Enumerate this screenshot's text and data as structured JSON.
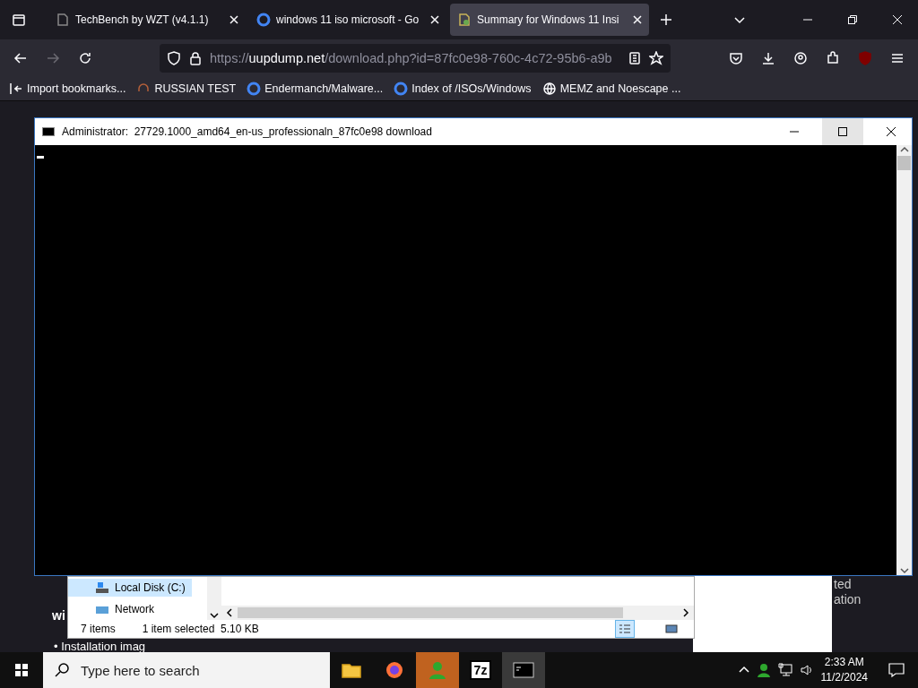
{
  "browser": {
    "tabs": [
      {
        "title": "TechBench by WZT (v4.1.1)",
        "selected": false
      },
      {
        "title": "windows 11 iso microsoft - Go",
        "selected": false
      },
      {
        "title": "Summary for Windows 11 Insi",
        "selected": true
      }
    ],
    "url": {
      "scheme": "https://",
      "host": "uupdump.net",
      "path": "/download.php?id=87fc0e98-760c-4c72-95b6-a9b"
    },
    "bookmarks": [
      {
        "label": "Import bookmarks..."
      },
      {
        "label": "RUSSIAN TEST"
      },
      {
        "label": "Endermanch/Malware..."
      },
      {
        "label": "Index of /ISOs/Windows"
      },
      {
        "label": "MEMZ and Noescape ..."
      }
    ]
  },
  "page": {
    "left_fragments": [
      "wi",
      "• Installation imag"
    ],
    "right_fragments": [
      "ted",
      "ation"
    ]
  },
  "explorer": {
    "nav_items": [
      {
        "label": "Local Disk (C:)",
        "selected": true
      },
      {
        "label": "Network",
        "selected": false
      }
    ],
    "status": {
      "count": "7 items",
      "selection": "1 item selected  5.10 KB"
    },
    "view_buttons": [
      {
        "selected": true
      },
      {
        "selected": false
      }
    ]
  },
  "console": {
    "title": "Administrator:  27729.1000_amd64_en-us_professionaln_87fc0e98 download"
  },
  "taskbar": {
    "search_placeholder": "Type here to search",
    "apps": [
      {
        "active": false
      },
      {
        "active": false
      },
      {
        "active": true
      },
      {
        "label": "7z",
        "active": false
      },
      {
        "active": true
      }
    ],
    "time": "2:33 AM",
    "date": "11/2/2024"
  }
}
